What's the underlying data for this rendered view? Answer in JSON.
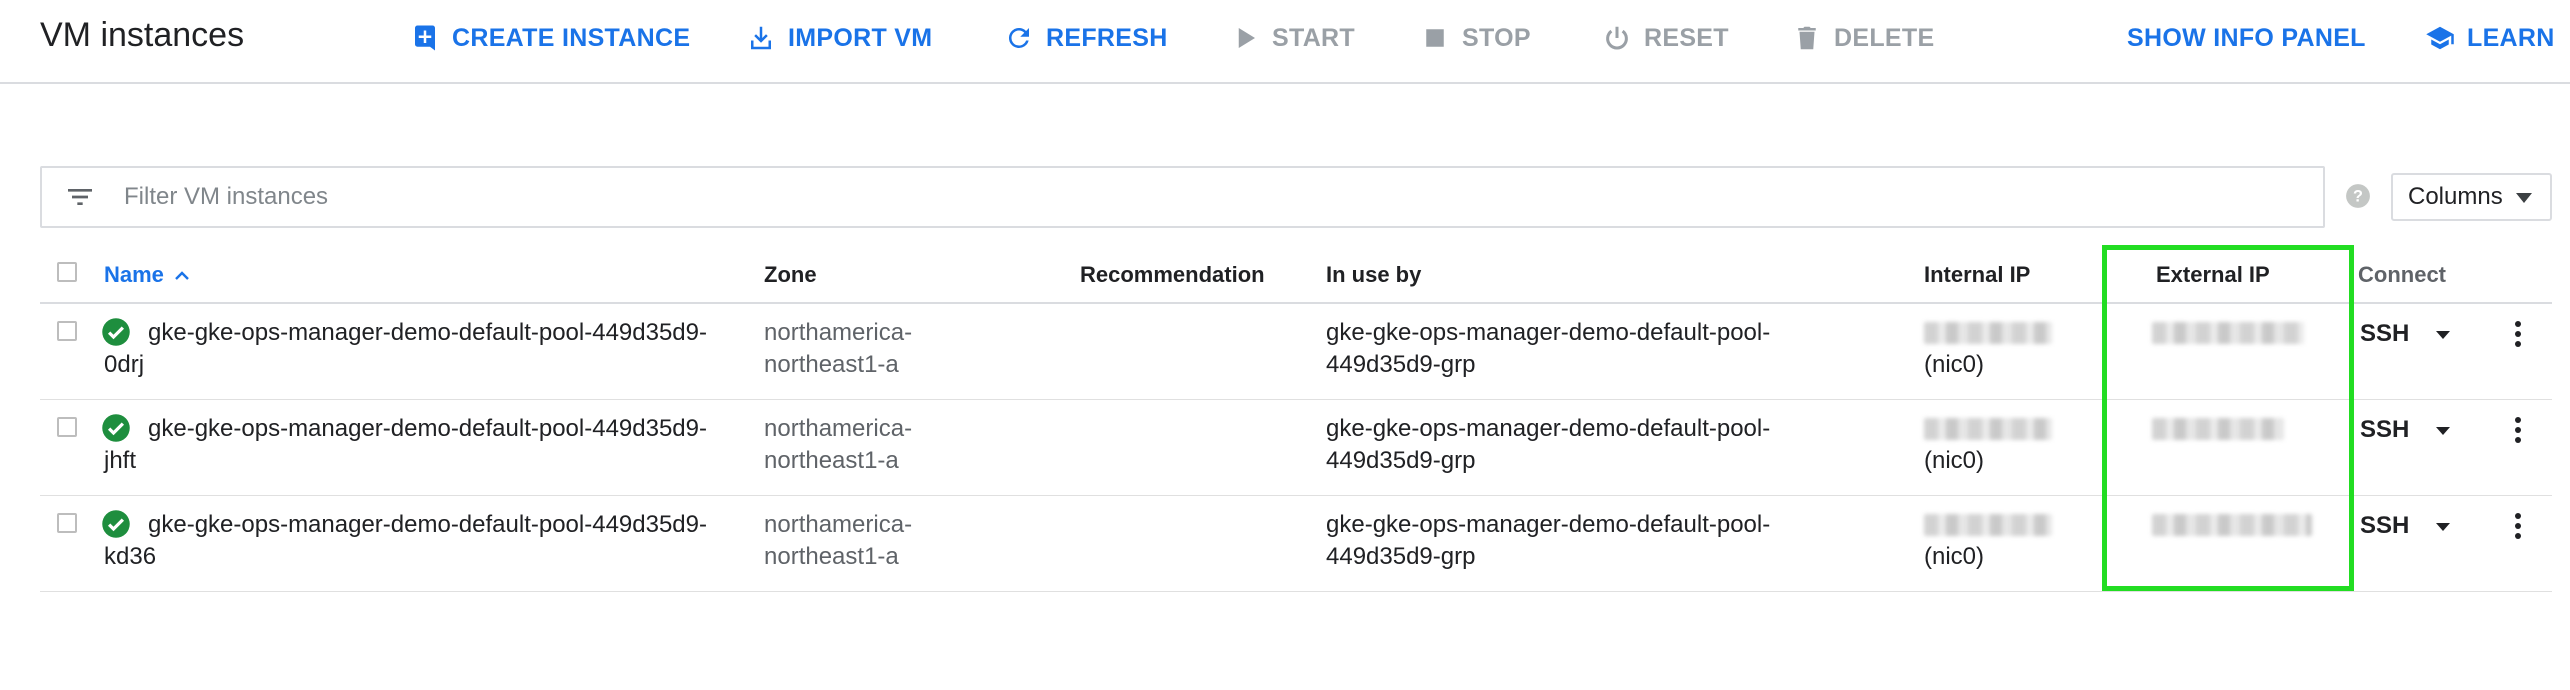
{
  "header": {
    "title": "VM instances",
    "actions": {
      "create": "CREATE INSTANCE",
      "import": "IMPORT VM",
      "refresh": "REFRESH",
      "start": "START",
      "stop": "STOP",
      "reset": "RESET",
      "delete": "DELETE",
      "info_panel": "SHOW INFO PANEL",
      "learn": "LEARN"
    }
  },
  "filter": {
    "placeholder": "Filter VM instances"
  },
  "columns_button": "Columns",
  "table": {
    "headers": {
      "name": "Name",
      "zone": "Zone",
      "recommendation": "Recommendation",
      "in_use_by": "In use by",
      "internal_ip": "Internal IP",
      "external_ip": "External IP",
      "connect": "Connect"
    },
    "rows": [
      {
        "name_line1": "gke-gke-ops-manager-demo-default-pool-449d35d9-",
        "name_line2": "0drj",
        "zone_line1": "northamerica-",
        "zone_line2": "northeast1-a",
        "in_use_line1": "gke-gke-ops-manager-demo-default-pool-",
        "in_use_line2": "449d35d9-grp",
        "internal_nic": "(nic0)",
        "connect": "SSH"
      },
      {
        "name_line1": "gke-gke-ops-manager-demo-default-pool-449d35d9-",
        "name_line2": "jhft",
        "zone_line1": "northamerica-",
        "zone_line2": "northeast1-a",
        "in_use_line1": "gke-gke-ops-manager-demo-default-pool-",
        "in_use_line2": "449d35d9-grp",
        "internal_nic": "(nic0)",
        "connect": "SSH"
      },
      {
        "name_line1": "gke-gke-ops-manager-demo-default-pool-449d35d9-",
        "name_line2": "kd36",
        "zone_line1": "northamerica-",
        "zone_line2": "northeast1-a",
        "in_use_line1": "gke-gke-ops-manager-demo-default-pool-",
        "in_use_line2": "449d35d9-grp",
        "internal_nic": "(nic0)",
        "connect": "SSH"
      }
    ]
  },
  "colors": {
    "accent": "#1a73e8",
    "disabled": "#9aa0a6",
    "status_ok": "#1e8e3e",
    "highlight": "#22dd22"
  },
  "icons": {
    "create": "add-box-icon",
    "import": "download-icon",
    "refresh": "refresh-icon",
    "start": "play-icon",
    "stop": "stop-icon",
    "reset": "power-icon",
    "delete": "trash-icon",
    "learn": "school-icon",
    "filter": "filter-list-icon",
    "help": "help-icon",
    "status": "check-circle-icon",
    "more": "more-vert-icon"
  }
}
